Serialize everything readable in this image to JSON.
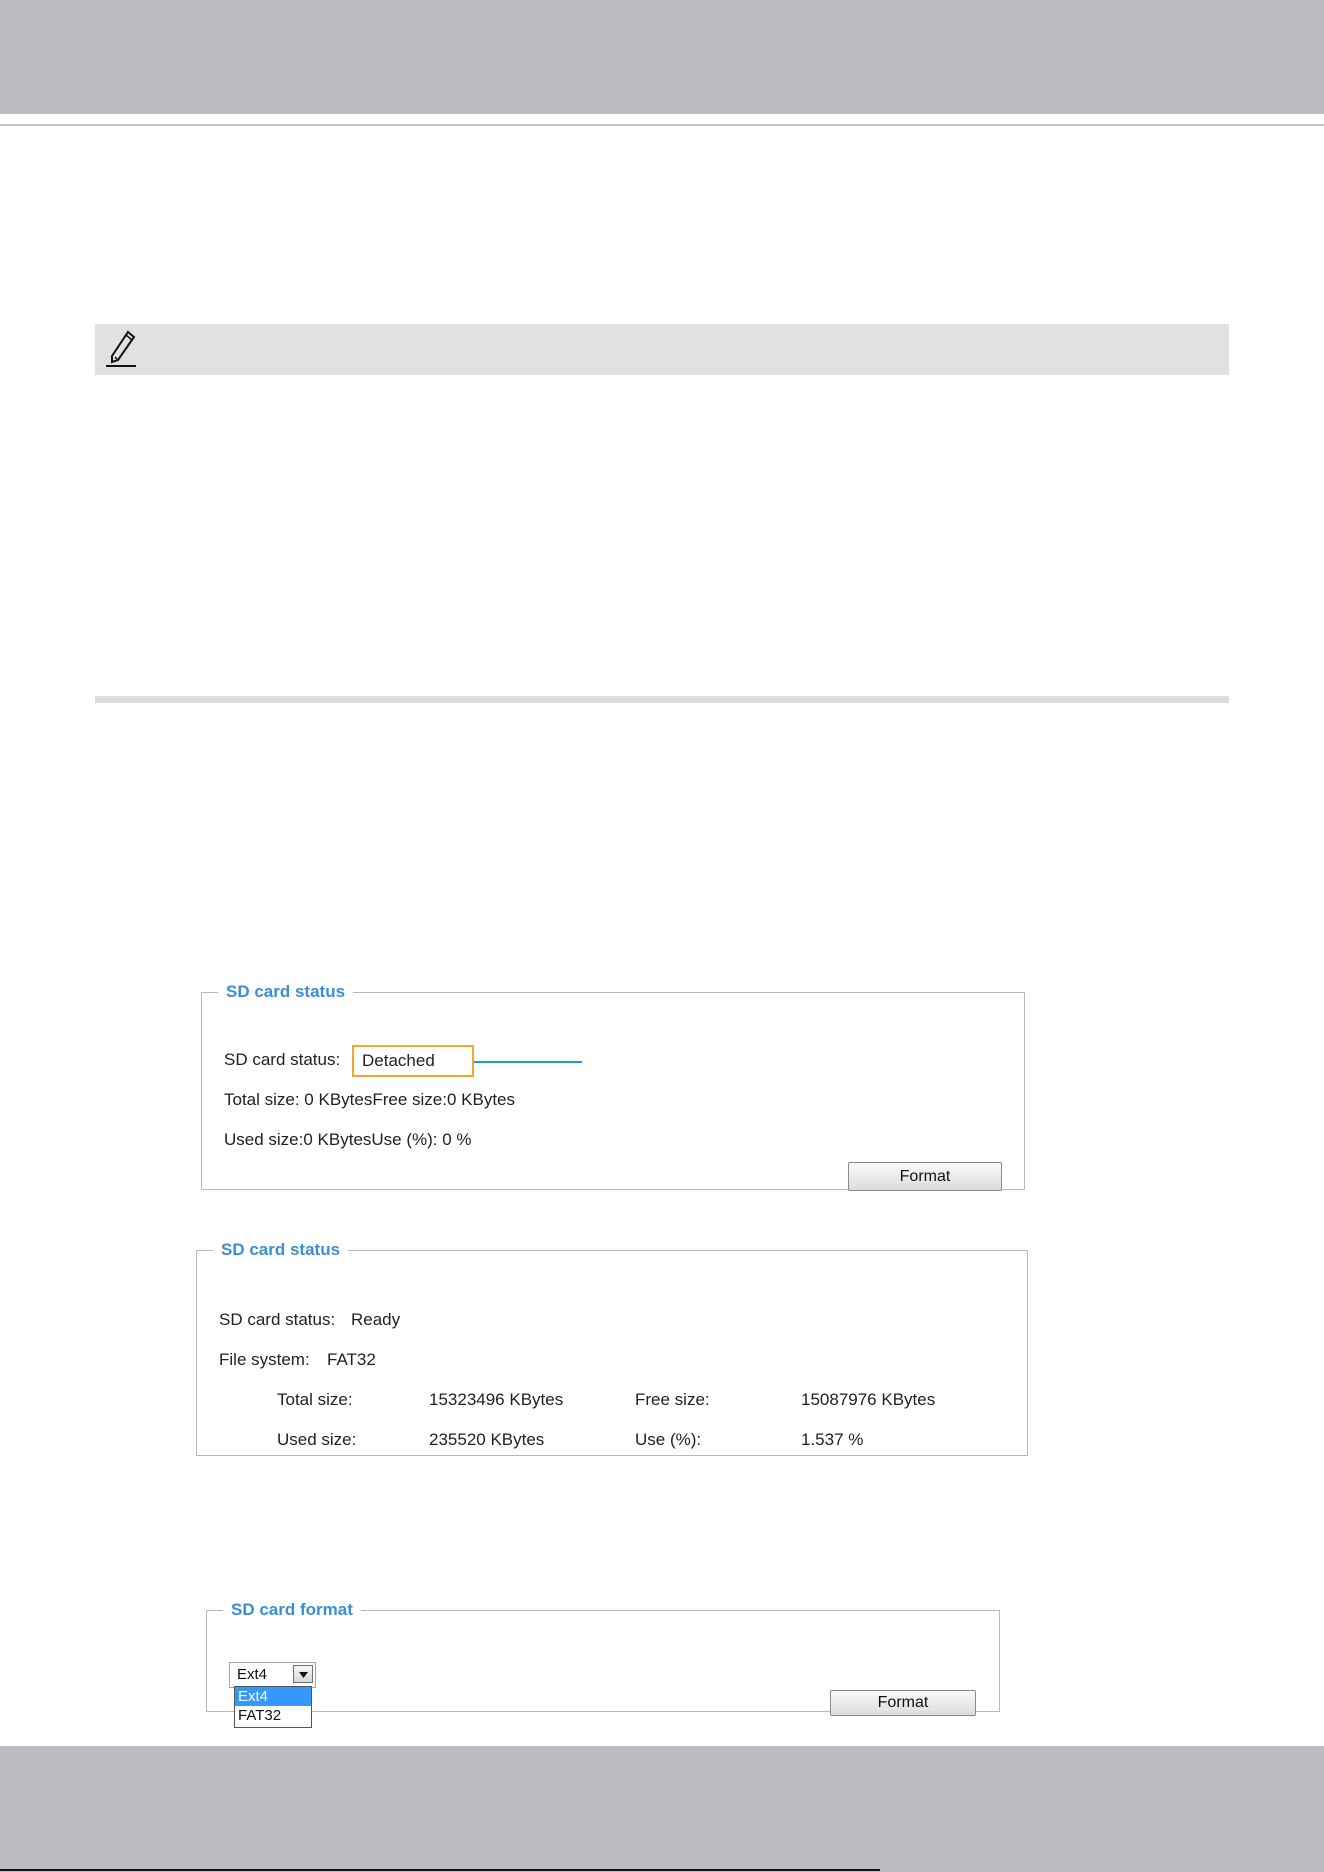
{
  "colors": {
    "legend_blue": "#3a8fd2",
    "highlight_orange": "#f5a623",
    "callout_blue": "#1e9ad6",
    "selected_option": "#3399ff"
  },
  "note": {
    "icon": "pencil-icon"
  },
  "panel_detached": {
    "legend": "SD card status",
    "status_label": "SD card status:",
    "status_value": "Detached",
    "line_total_free": "Total size: 0  KBytesFree size:0  KBytes",
    "line_used": "Used size:0  KBytesUse (%):  0 %",
    "format_button": "Format"
  },
  "panel_ready": {
    "legend": "SD card status",
    "status_label": "SD card status:",
    "status_value": "Ready",
    "fs_label": "File system:",
    "fs_value": "FAT32",
    "total_label": "Total size:",
    "total_value": "15323496  KBytes",
    "free_label": "Free size:",
    "free_value": "15087976  KBytes",
    "used_label": "Used size:",
    "used_value": "235520  KBytes",
    "use_pct_label": "Use (%):",
    "use_pct_value": "1.537 %"
  },
  "panel_format": {
    "legend": "SD card format",
    "selected": "Ext4",
    "options": [
      "Ext4",
      "FAT32"
    ],
    "format_button": "Format"
  }
}
